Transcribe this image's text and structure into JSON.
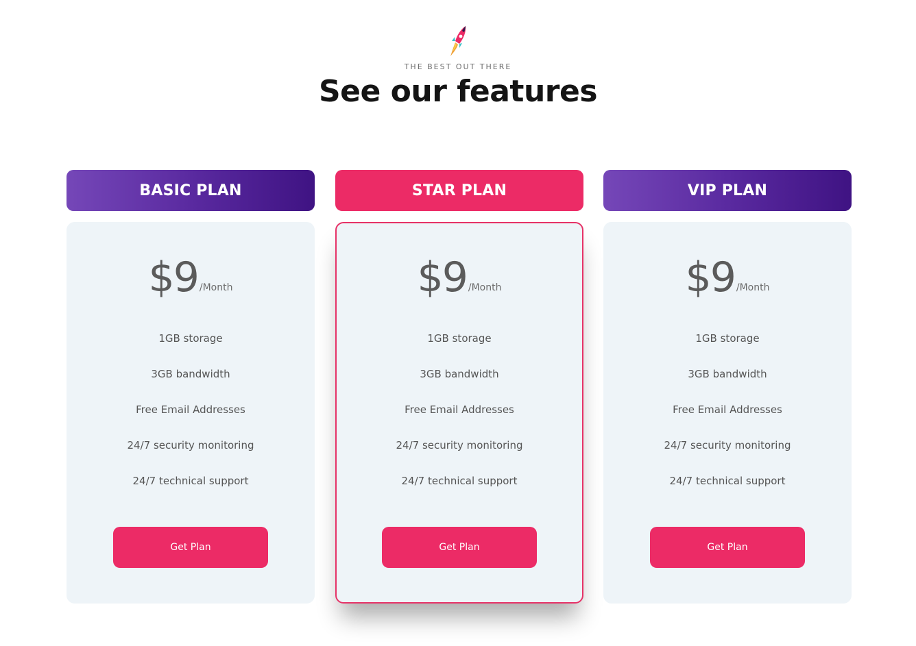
{
  "section": {
    "eyebrow": "THE BEST OUT THERE",
    "title": "See our features",
    "icon": "rocket-icon"
  },
  "colors": {
    "accent_pink": "#ec2b66",
    "purple_start": "#7547b8",
    "purple_end": "#3f1383",
    "card_bg": "#eef4f8"
  },
  "plans": [
    {
      "name": "BASIC PLAN",
      "price": "$9",
      "period": "/Month",
      "features": [
        "1GB storage",
        "3GB bandwidth",
        "Free Email Addresses",
        "24/7 security monitoring",
        "24/7 technical support"
      ],
      "button": "Get Plan"
    },
    {
      "name": "STAR PLAN",
      "price": "$9",
      "period": "/Month",
      "features": [
        "1GB storage",
        "3GB bandwidth",
        "Free Email Addresses",
        "24/7 security monitoring",
        "24/7 technical support"
      ],
      "button": "Get Plan"
    },
    {
      "name": "VIP PLAN",
      "price": "$9",
      "period": "/Month",
      "features": [
        "1GB storage",
        "3GB bandwidth",
        "Free Email Addresses",
        "24/7 security monitoring",
        "24/7 technical support"
      ],
      "button": "Get Plan"
    }
  ]
}
